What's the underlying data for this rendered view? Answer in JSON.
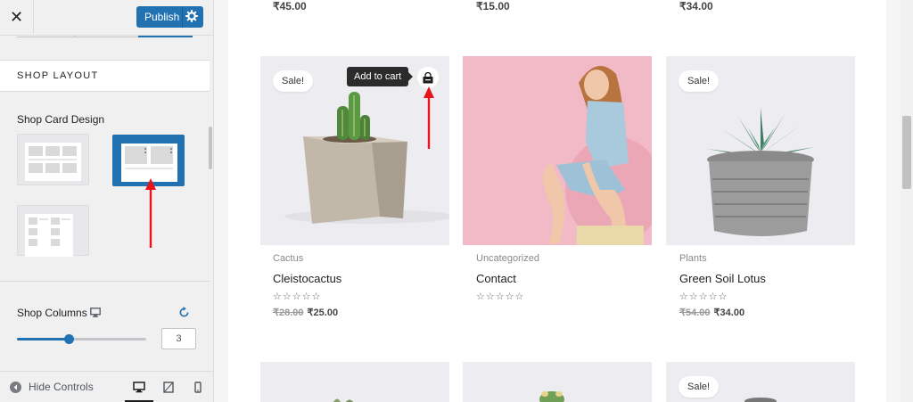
{
  "sidebar": {
    "close_label": "✕",
    "publish_label": "Publish",
    "section_title": "SHOP LAYOUT",
    "card_design_label": "Shop Card Design",
    "columns_label": "Shop Columns",
    "columns_value": "3",
    "columns_slider_fraction": 0.4,
    "hide_controls_label": "Hide Controls",
    "accent": "#2271b1"
  },
  "preview": {
    "top_prices": [
      "₹45.00",
      "₹15.00",
      "₹34.00"
    ],
    "tooltip": "Add to cart",
    "products": [
      {
        "sale": "Sale!",
        "category": "Cactus",
        "title": "Cleistocactus",
        "stars": "☆☆☆☆☆",
        "old_price": "₹28.00",
        "price": "₹25.00"
      },
      {
        "sale": "",
        "category": "Uncategorized",
        "title": "Contact",
        "stars": "☆☆☆☆☆",
        "old_price": "",
        "price": ""
      },
      {
        "sale": "Sale!",
        "category": "Plants",
        "title": "Green Soil Lotus",
        "stars": "☆☆☆☆☆",
        "old_price": "₹54.00",
        "price": "₹34.00"
      }
    ],
    "bottom_sale": "Sale!"
  }
}
